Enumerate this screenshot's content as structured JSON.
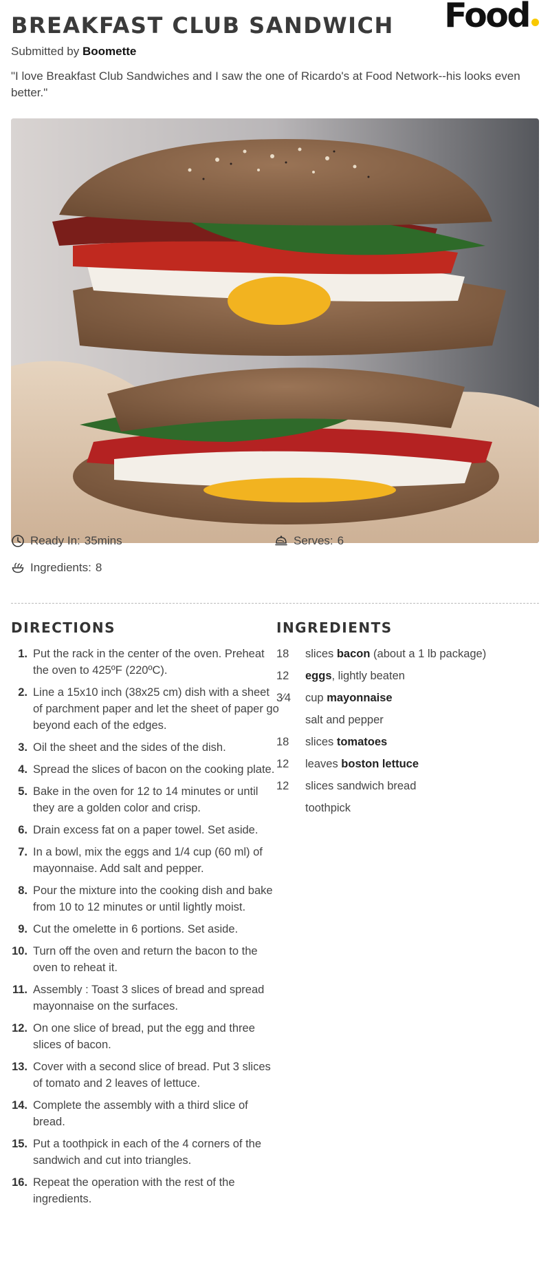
{
  "recipe": {
    "title": "BREAKFAST CLUB SANDWICH",
    "brand": "Food",
    "brand_color": "#f9c900",
    "submitted_prefix": "Submitted by",
    "author": "Boomette",
    "description": "\"I love Breakfast Club Sandwiches and I saw the one of Ricardo's at Food Network--his looks even better.\""
  },
  "meta": {
    "ready_label": "Ready In:",
    "ready_value": "35mins",
    "serves_label": "Serves:",
    "serves_value": "6",
    "ingredients_label": "Ingredients:",
    "ingredients_value": "8",
    "icons": [
      "clock-icon",
      "serving-dome-icon",
      "ingredients-bowl-icon"
    ]
  },
  "directions": {
    "heading": "DIRECTIONS",
    "steps": [
      {
        "num": "1.",
        "text": "Put the rack in the center of the oven. Preheat the oven to 425ºF (220ºC)."
      },
      {
        "num": "2.",
        "text": "Line a 15x10 inch (38x25 cm) dish with a sheet of parchment paper and let the sheet of paper go beyond each of the edges."
      },
      {
        "num": "3.",
        "text": "Oil the sheet and the sides of the dish."
      },
      {
        "num": "4.",
        "text": "Spread the slices of bacon on the cooking plate."
      },
      {
        "num": "5.",
        "text": "Bake in the oven for 12 to 14 minutes or until they are a golden color and crisp."
      },
      {
        "num": "6.",
        "text": "Drain excess fat on a paper towel. Set aside."
      },
      {
        "num": "7.",
        "text": "In a bowl, mix the eggs and 1/4 cup (60 ml) of mayonnaise. Add salt and pepper."
      },
      {
        "num": "8.",
        "text": "Pour the mixture into the cooking dish and bake from 10 to 12 minutes or until lightly moist."
      },
      {
        "num": "9.",
        "text": "Cut the omelette in 6 portions. Set aside."
      },
      {
        "num": "10.",
        "text": "Turn off the oven and return the bacon to the oven to reheat it."
      },
      {
        "num": "11.",
        "text": "Assembly : Toast 3 slices of bread and spread mayonnaise on the surfaces."
      },
      {
        "num": "12.",
        "text": "On one slice of bread, put the egg and three slices of bacon."
      },
      {
        "num": "13.",
        "text": "Cover with a second slice of bread. Put 3 slices of tomato and 2 leaves of lettuce."
      },
      {
        "num": "14.",
        "text": "Complete the assembly with a third slice of bread."
      },
      {
        "num": "15.",
        "text": "Put a toothpick in each of the 4 corners of the sandwich and cut into triangles."
      },
      {
        "num": "16.",
        "text": "Repeat the operation with the rest of the ingredients."
      }
    ]
  },
  "ingredients": {
    "heading": "INGREDIENTS",
    "items": [
      {
        "qty": "18",
        "pre": "slices ",
        "name": "bacon",
        "post": " (about a 1 lb package)"
      },
      {
        "qty": "12",
        "pre": "",
        "name": "eggs",
        "post": ", lightly beaten"
      },
      {
        "qty": "3⁄4",
        "pre": "cup ",
        "name": "mayonnaise",
        "post": ""
      },
      {
        "qty": "",
        "pre": "salt and pepper",
        "name": "",
        "post": ""
      },
      {
        "qty": "18",
        "pre": "slices ",
        "name": "tomatoes",
        "post": ""
      },
      {
        "qty": "12",
        "pre": "leaves ",
        "name": "boston lettuce",
        "post": ""
      },
      {
        "qty": "12",
        "pre": "slices sandwich bread",
        "name": "",
        "post": ""
      },
      {
        "qty": "",
        "pre": "toothpick",
        "name": "",
        "post": ""
      }
    ]
  }
}
